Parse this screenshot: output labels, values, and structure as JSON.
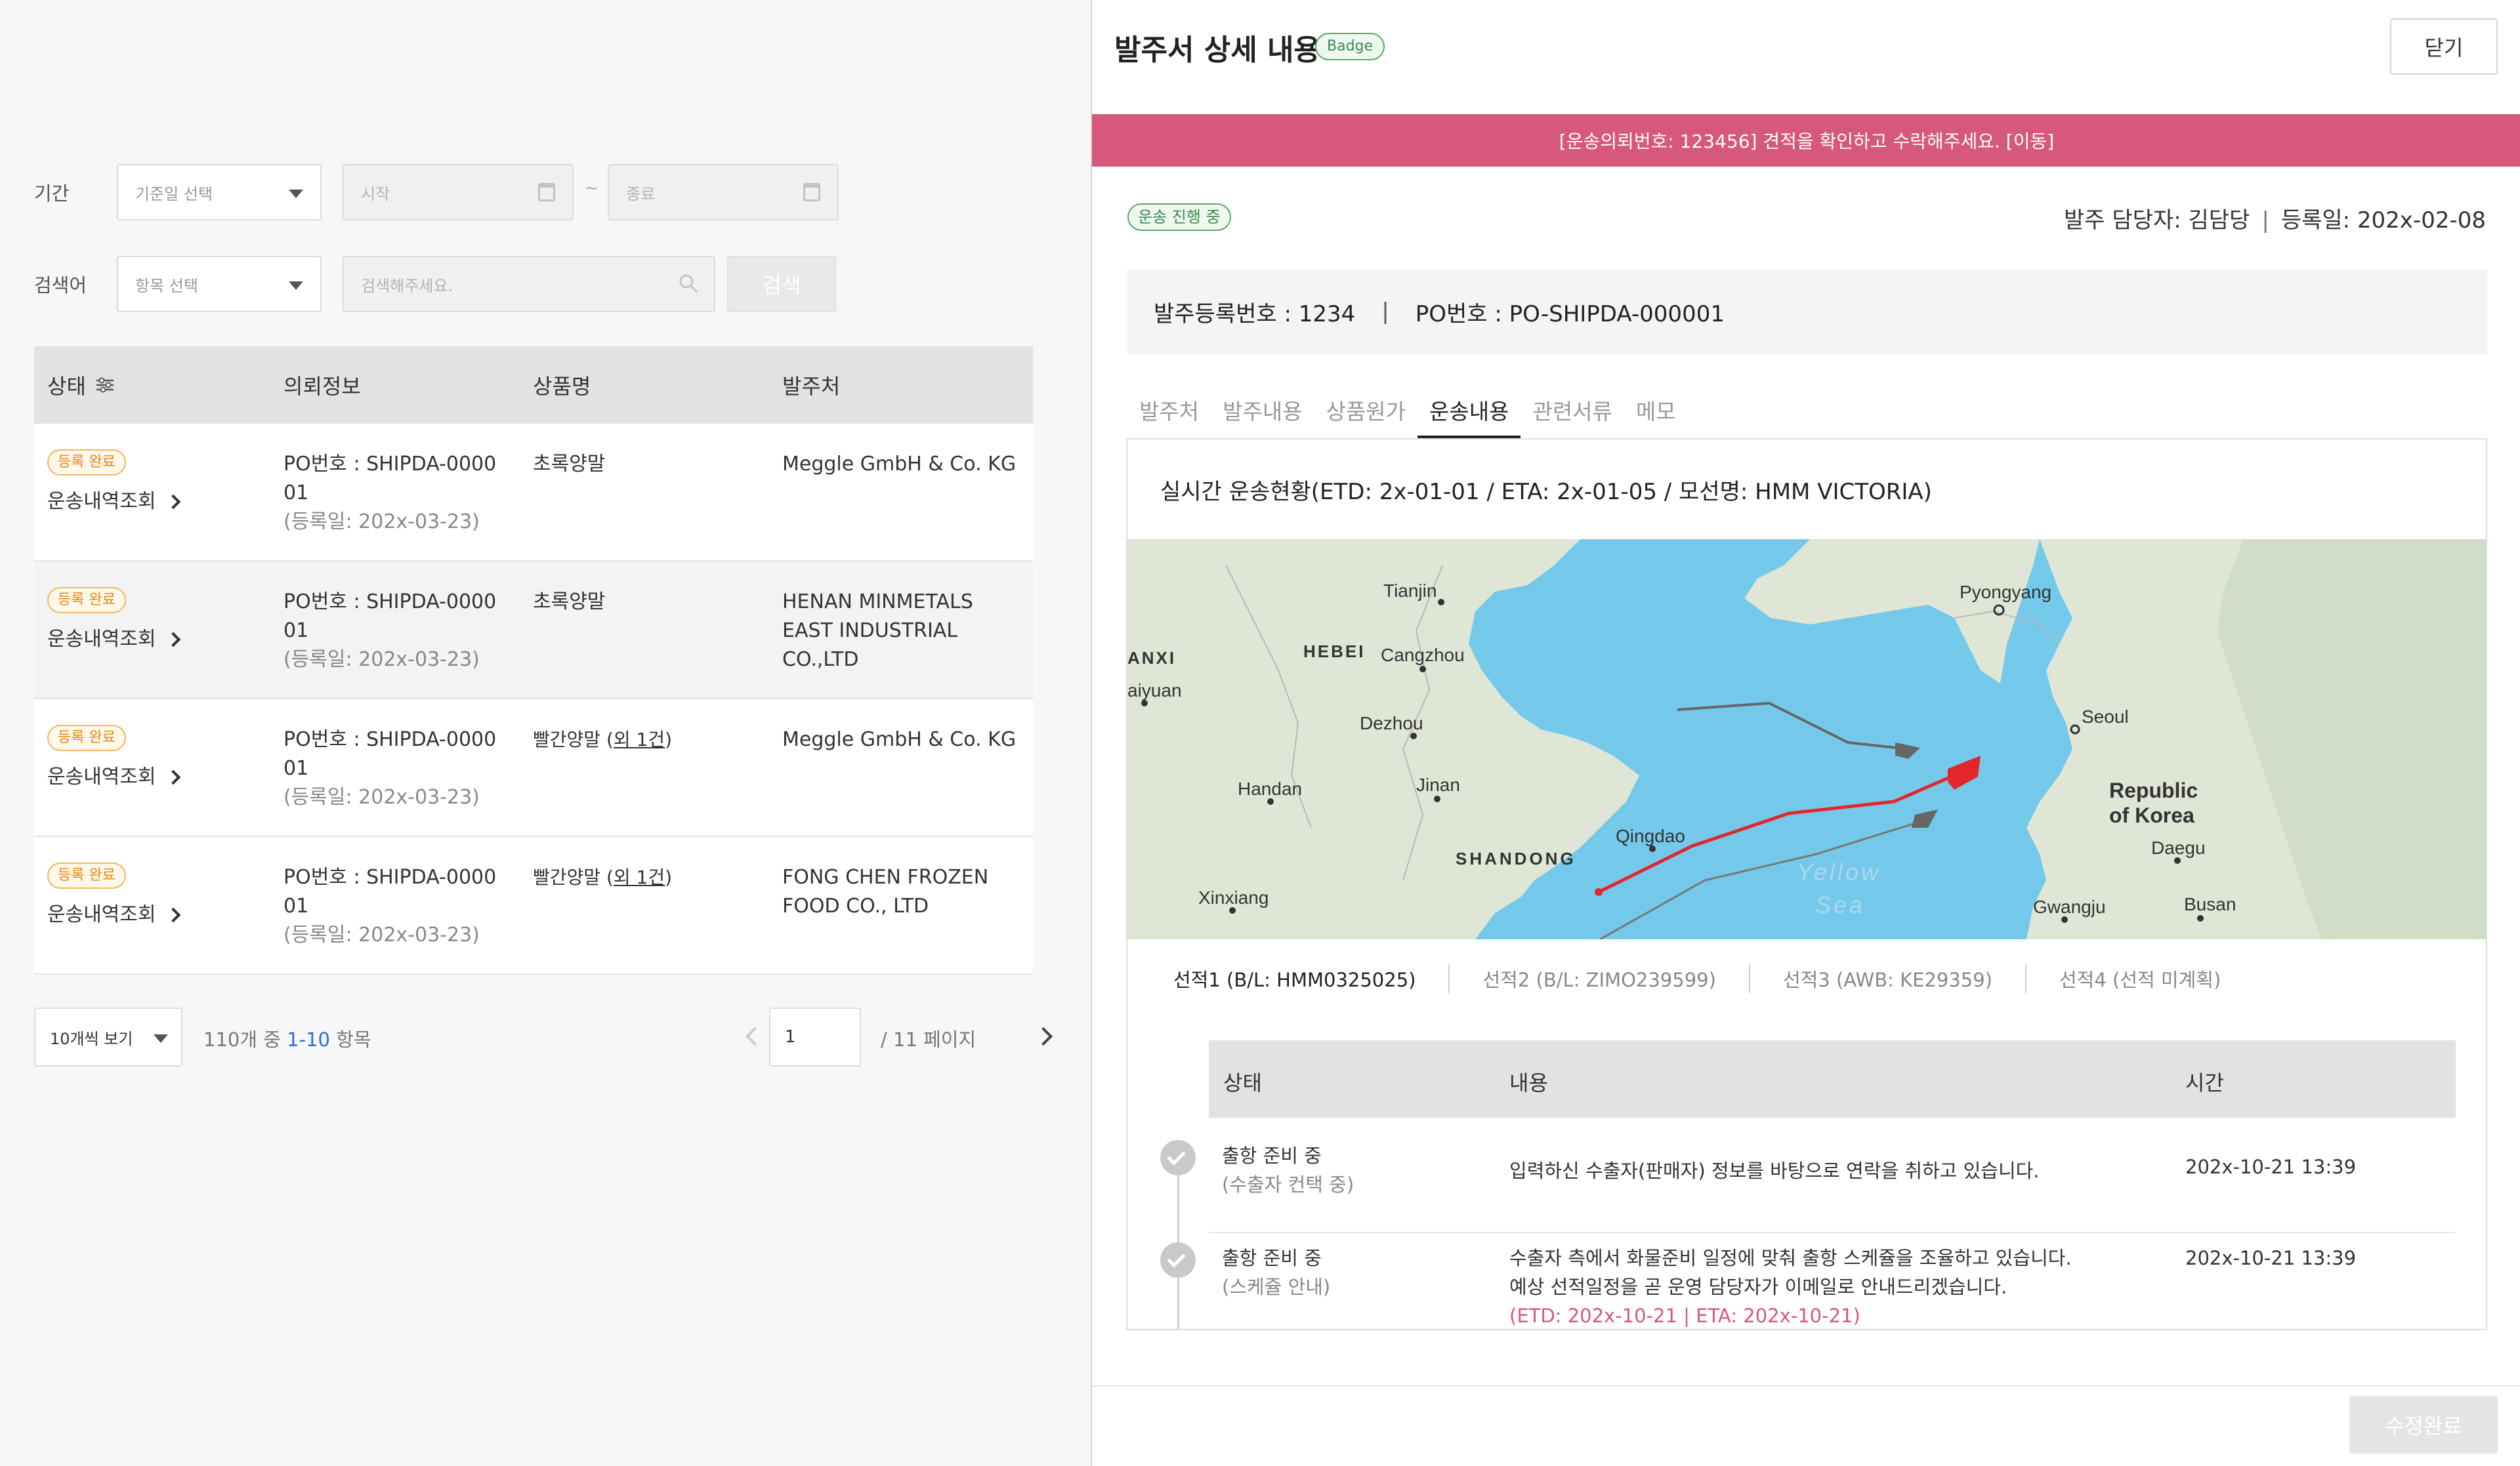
{
  "filters": {
    "period_label": "기간",
    "date_type_placeholder": "기준일 선택",
    "start_placeholder": "시작",
    "range_sep": "~",
    "end_placeholder": "종료",
    "search_label": "검색어",
    "item_placeholder": "항목 선택",
    "keyword_placeholder": "검색해주세요.",
    "search_button": "검색"
  },
  "table": {
    "headers": [
      "상태",
      "의뢰정보",
      "상품명",
      "발주처"
    ],
    "rows": [
      {
        "status": "등록 완료",
        "history": "운송내역조회",
        "po1": "PO번호 : SHIPDA-0000",
        "po2": "01",
        "reg": "(등록일: 202x-03-23)",
        "product": "초록양말",
        "more": "",
        "supplier1": "Meggle GmbH & Co. KG",
        "supplier2": "",
        "supplier3": ""
      },
      {
        "status": "등록 완료",
        "history": "운송내역조회",
        "po1": "PO번호 : SHIPDA-0000",
        "po2": "01",
        "reg": "(등록일: 202x-03-23)",
        "product": "초록양말",
        "more": "",
        "supplier1": "HENAN MINMETALS",
        "supplier2": "EAST INDUSTRIAL",
        "supplier3": "CO.,LTD"
      },
      {
        "status": "등록 완료",
        "history": "운송내역조회",
        "po1": "PO번호 : SHIPDA-0000",
        "po2": "01",
        "reg": "(등록일: 202x-03-23)",
        "product": "빨간양말 (",
        "more": "외 1건",
        "supplier1": "Meggle GmbH & Co. KG",
        "supplier2": "",
        "supplier3": ""
      },
      {
        "status": "등록 완료",
        "history": "운송내역조회",
        "po1": "PO번호 : SHIPDA-0000",
        "po2": "01",
        "reg": "(등록일: 202x-03-23)",
        "product": "빨간양말 (",
        "more": "외 1건",
        "supplier1": "FONG CHEN FROZEN",
        "supplier2": "FOOD CO., LTD",
        "supplier3": ""
      }
    ]
  },
  "pager": {
    "per_page": "10개씩 보기",
    "info_prefix": "110개 중 ",
    "info_range": "1-10",
    "info_suffix": " 항목",
    "page_value": "1",
    "total": "/ 11 페이지"
  },
  "detail": {
    "title": "발주서 상세 내용",
    "badge": "Badge",
    "close": "닫기",
    "banner": "[운송의뢰번호: 123456] 견적을 확인하고 수락해주세요. [이동]",
    "status": "운송 진행 중",
    "manager": "발주 담당자: 김담당",
    "meta_sep": "|",
    "reg_date": "등록일: 202x-02-08",
    "reg_no": "발주등록번호 : 1234",
    "po_sep": "|",
    "po_no": "PO번호 : PO-SHIPDA-000001",
    "tabs": [
      "발주처",
      "발주내용",
      "상품원가",
      "운송내용",
      "관련서류",
      "메모"
    ],
    "active_tab": "운송내용",
    "realtime_title": "실시간 운송현황(ETD: 2x-01-01 / ETA: 2x-01-05 / 모선명: HMM VICTORIA)",
    "map_labels": {
      "tianjin": "Tianjin",
      "pyongyang": "Pyongyang",
      "anxi": "ANXI",
      "hebei": "HEBEI",
      "cangzhou": "Cangzhou",
      "taiyuan": "aiyuan",
      "seoul": "Seoul",
      "dezhou": "Dezhou",
      "handan": "Handan",
      "jinan": "Jinan",
      "rok1": "Republic",
      "rok2": "of Korea",
      "daegu": "Daegu",
      "qingdao": "Qingdao",
      "shandong": "SHANDONG",
      "yellow": "Yellow",
      "sea": "Sea",
      "xinxiang": "Xinxiang",
      "gwangju": "Gwangju",
      "busan": "Busan"
    },
    "vessels": [
      "선적1 (B/L: HMM0325025)",
      "선적2 (B/L: ZIMO239599)",
      "선적3 (AWB: KE29359)",
      "선적4 (선적 미계획)"
    ],
    "timeline_headers": [
      "상태",
      "내용",
      "시간"
    ],
    "timeline": [
      {
        "status": "출항 준비 중",
        "sub": "(수출자 컨택 중)",
        "content1": "입력하신 수출자(판매자) 정보를 바탕으로 연락을 취하고 있습니다.",
        "content2": "",
        "eta": "",
        "time": "202x-10-21 13:39"
      },
      {
        "status": "출항 준비 중",
        "sub": "(스케쥴 안내)",
        "content1": "수출자 측에서 화물준비 일정에 맞춰 출항 스케쥴을 조율하고 있습니다.",
        "content2": "예상 선적일정을 곧 운영 담당자가 이메일로 안내드리겠습니다.",
        "eta": "(ETD: 202x-10-21 | ETA: 202x-10-21)",
        "time": "202x-10-21 13:39"
      }
    ],
    "save": "수정완료"
  },
  "colors": {
    "banner": "#d6587c",
    "accent_link": "#2b6fd6",
    "tag_orange": "#e58a13",
    "sea": "#74c9ea",
    "route": "#e3262c"
  }
}
